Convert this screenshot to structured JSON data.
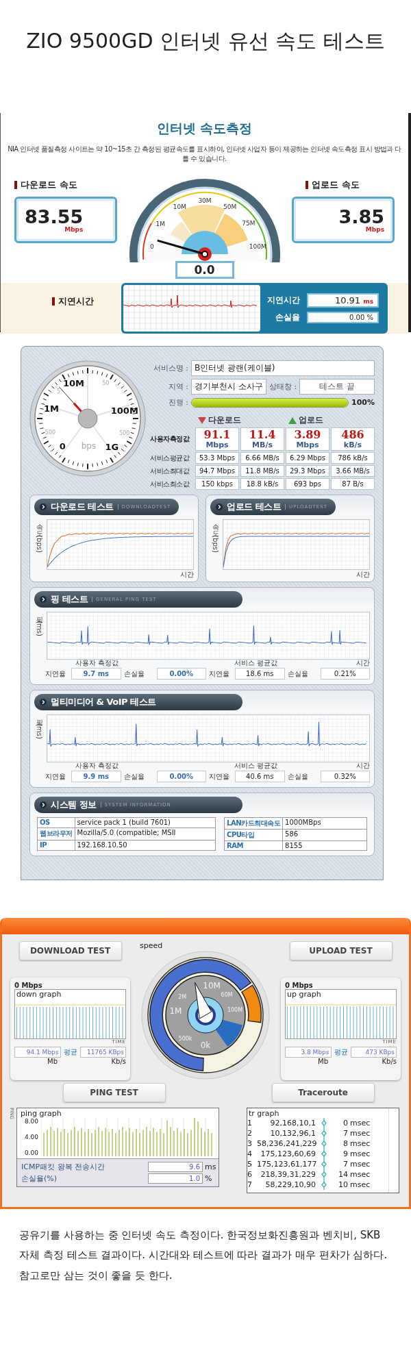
{
  "title": "ZIO 9500GD 인터넷 유선 속도 테스트",
  "nia": {
    "title": "인터넷 속도측정",
    "notice": "NIA 인터넷 품질측정 사이트는 약 10~15초 간 측정된 평균속도를 표시하여, 인터넷 사업자 등이 제공하는 인터넷 속도측정 표시 방법과 다를 수 있습니다.",
    "download": {
      "label": "다운로드 속도",
      "value": "83.55",
      "unit": "Mbps"
    },
    "upload": {
      "label": "업로드 속도",
      "value": "3.85",
      "unit": "Mbps"
    },
    "gauge": {
      "ticks": [
        "0",
        "1M",
        "10M",
        "30M",
        "50M",
        "75M",
        "100M"
      ],
      "reading": "0.0"
    },
    "latency": {
      "label": "지연시간",
      "delay_label": "지연시간",
      "delay_value": "10.91",
      "delay_unit": "ms",
      "loss_label": "손실율",
      "loss_value": "0.00 %"
    }
  },
  "benchbee": {
    "gauge": {
      "labels": [
        {
          "text": "10M",
          "kind": "major"
        },
        {
          "text": "5",
          "kind": "minor"
        },
        {
          "text": "50",
          "kind": "minor"
        },
        {
          "text": "1M",
          "kind": "major"
        },
        {
          "text": "100M",
          "kind": "major"
        },
        {
          "text": "500",
          "kind": "minor"
        },
        {
          "text": "500",
          "kind": "minor"
        },
        {
          "text": "0",
          "kind": "major"
        },
        {
          "text": "bps",
          "kind": "unit"
        },
        {
          "text": "1G",
          "kind": "major"
        }
      ]
    },
    "service_label": "서비스명 :",
    "service": "B인터넷 광랜(케이블)",
    "region_label": "지역 :",
    "region": "경기부천시 소사구",
    "status_label": "상태창 :",
    "status": "테스트 끝",
    "progress_label": "진행 :",
    "progress": {
      "level": 1,
      "text": "100%"
    },
    "results": {
      "download_label": "다운로드",
      "upload_label": "업로드",
      "rows": [
        {
          "label": "사용자측정값",
          "kind": "user",
          "cells": [
            {
              "value": "91.1",
              "unit": "Mbps"
            },
            {
              "value": "11.4",
              "unit": "MB/s"
            },
            {
              "value": "3.89",
              "unit": "Mbps"
            },
            {
              "value": "486",
              "unit": "kB/s"
            }
          ]
        },
        {
          "label": "서비스평균값",
          "kind": "service",
          "cells": [
            {
              "value": "53.3 Mbps"
            },
            {
              "value": "6.66 MB/s"
            },
            {
              "value": "6.29 Mbps"
            },
            {
              "value": "786 kB/s"
            }
          ]
        },
        {
          "label": "서비스최대값",
          "kind": "service",
          "cells": [
            {
              "value": "94.7 Mbps"
            },
            {
              "value": "11.8 MB/s"
            },
            {
              "value": "29.3 Mbps"
            },
            {
              "value": "3.66 MB/s"
            }
          ]
        },
        {
          "label": "서비스최소값",
          "kind": "service",
          "cells": [
            {
              "value": "150 kbps"
            },
            {
              "value": "18.8 kB/s"
            },
            {
              "value": "693 bps"
            },
            {
              "value": "87 B/s"
            }
          ]
        }
      ]
    },
    "speed_tests": [
      {
        "title": "다운로드 테스트",
        "subtitle": "DOWNLOADTEST",
        "y_label": "속도 (bps)",
        "x_label": "시간"
      },
      {
        "title": "업로드 테스트",
        "subtitle": "UPLOADTEST",
        "y_label": "속도 (bps)",
        "x_label": "시간"
      }
    ],
    "ping_tests": [
      {
        "title": "핑 테스트",
        "subtitle": "GENERAL PING TEST",
        "y_label": "핑 (ms)",
        "x_label": "시간",
        "user_label": "사용자 측정값",
        "service_label": "서비스 평균값",
        "stats": [
          {
            "label": "지연율",
            "value": "9.7 ms",
            "kind": "user"
          },
          {
            "label": "손실율",
            "value": "0.00%",
            "kind": "user"
          },
          {
            "label": "지연율",
            "value": "18.6 ms",
            "kind": "service"
          },
          {
            "label": "손실율",
            "value": "0.21%",
            "kind": "service"
          }
        ]
      },
      {
        "title": "멀티미디어 & VoIP 테스트",
        "y_label": "핑 (ms)",
        "x_label": "시간",
        "user_label": "사용자 측정값",
        "service_label": "서비스 평균값",
        "stats": [
          {
            "label": "지연율",
            "value": "9.9 ms",
            "kind": "user"
          },
          {
            "label": "손실율",
            "value": "0.00%",
            "kind": "user"
          },
          {
            "label": "지연율",
            "value": "40.6 ms",
            "kind": "service"
          },
          {
            "label": "손실율",
            "value": "0.32%",
            "kind": "service"
          }
        ]
      }
    ],
    "system": {
      "title": "시스템 정보",
      "subtitle": "SYSTEM INFORMATION",
      "left": [
        {
          "label": "OS",
          "value": "service pack 1 (build 7601)"
        },
        {
          "label": "웹브라우저",
          "value": "Mozilla/5.0 (compatible; MSII"
        },
        {
          "label": "IP",
          "value": "192.168.10.50"
        }
      ],
      "right": [
        {
          "label": "LAN카드최대속도",
          "value": "1000MBps"
        },
        {
          "label": "CPU타입",
          "value": "586"
        },
        {
          "label": "RAM",
          "value": "8155"
        }
      ]
    }
  },
  "sk": {
    "speed_label": "speed",
    "gauge_ticks": [
      "10M",
      "2M",
      "60M",
      "1M",
      "100M",
      "500k",
      "0k"
    ],
    "download": {
      "tab": "DOWNLOAD TEST",
      "rate": "0 Mbps",
      "graph_label": "down graph",
      "time_label": "TIME",
      "mbps": "94.1 Mbps",
      "avg_label": "평균",
      "kbps": "11765 KBps",
      "mb_label": "Mb",
      "kb_label": "Kb/s"
    },
    "upload": {
      "tab": "UPLOAD TEST",
      "rate": "0 Mbps",
      "graph_label": "up graph",
      "time_label": "TIME",
      "mbps": "3.8 Mbps",
      "avg_label": "평균",
      "kbps": "473 KBps",
      "mb_label": "Mb",
      "kb_label": "Kb/s"
    },
    "ping": {
      "tab": "PING TEST",
      "axis_label": "PING",
      "graph_label": "ping graph",
      "yticks": [
        "8.00",
        "4.00",
        "0.00"
      ],
      "rtt_label": "ICMP패킷 왕복 전송시간",
      "rtt_value": "9.6",
      "rtt_unit": "ms",
      "loss_label": "손실율(%)",
      "loss_value": "1.0",
      "loss_unit": "%"
    },
    "traceroute": {
      "tab": "Traceroute",
      "graph_label": "tr graph",
      "hops": [
        {
          "index": "1",
          "ip": "92,168,10,1",
          "time": "0",
          "unit": "msec"
        },
        {
          "index": "2",
          "ip": "10,132,96,1",
          "time": "7",
          "unit": "msec"
        },
        {
          "index": "3",
          "ip": "58,236,241,229",
          "time": "8",
          "unit": "msec"
        },
        {
          "index": "4",
          "ip": "175,123,60,69",
          "time": "9",
          "unit": "msec"
        },
        {
          "index": "5",
          "ip": "175,123,61,177",
          "time": "7",
          "unit": "msec"
        },
        {
          "index": "6",
          "ip": "218,39,31,229",
          "time": "14",
          "unit": "msec"
        },
        {
          "index": "7",
          "ip": "58,229,10,90",
          "time": "10",
          "unit": "msec"
        }
      ]
    }
  },
  "paragraph": "공유기를 사용하는 중 인터넷 속도 측정이다.  한국정보화진흥원과 벤치비, SKB 자체 측정 테스트 결과이다. 시간대와 테스트에 따라 결과가 매우 편차가 심하다. 참고로만 삼는 것이 좋을 듯 한다."
}
